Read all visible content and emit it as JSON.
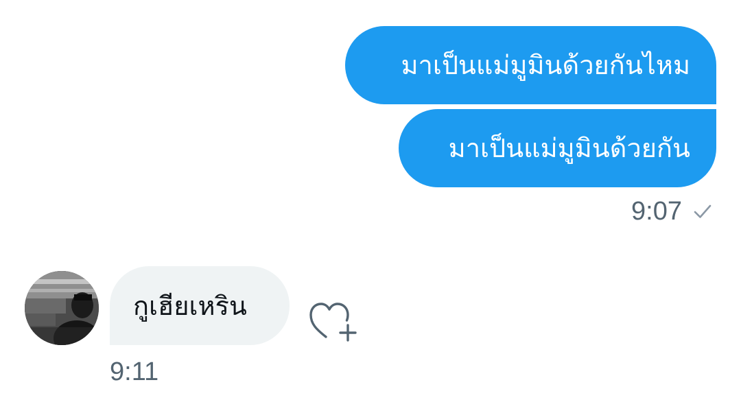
{
  "conversation": {
    "sent_messages": [
      {
        "text": "มาเป็นแม่มูมินด้วยกันไหม"
      },
      {
        "text": "มาเป็นแม่มูมินด้วยกัน"
      }
    ],
    "sent_time": "9:07",
    "sent_status_icon": "checkmark-icon",
    "received_message": {
      "text": "กูเฮียเหริน"
    },
    "received_time": "9:11",
    "reaction_icon": "heart-plus-icon"
  },
  "colors": {
    "sent_bubble": "#1d9bf0",
    "received_bubble": "#eff3f4",
    "meta_text": "#536471"
  }
}
